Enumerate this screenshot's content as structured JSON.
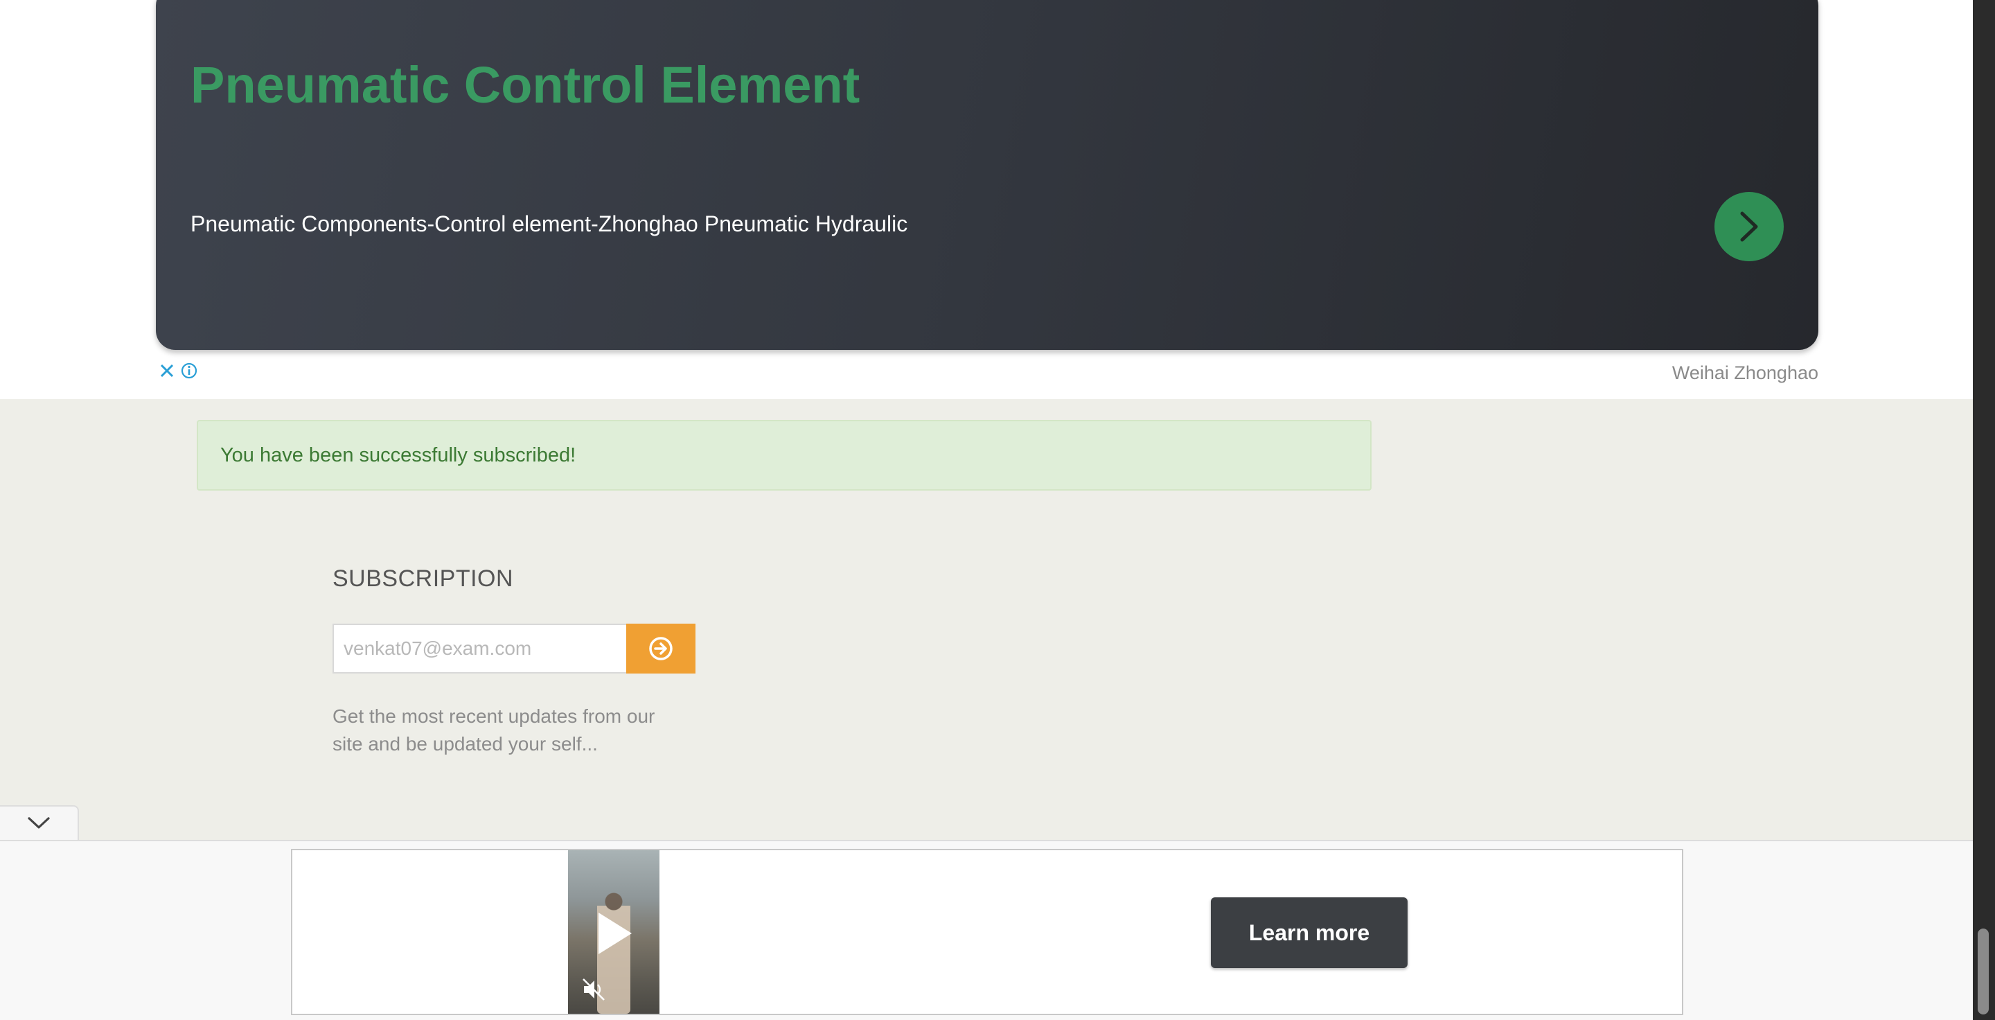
{
  "top_ad": {
    "title": "Pneumatic Control Element",
    "description": "Pneumatic Components-Control element-Zhonghao Pneumatic Hydraulic",
    "advertiser": "Weihai Zhonghao",
    "title_color": "#3a9a62",
    "arrow_color": "#2f8f55",
    "icons": [
      "close-icon",
      "info-icon",
      "chevron-right-icon"
    ]
  },
  "alert": {
    "message": "You have been successfully subscribed!"
  },
  "subscription": {
    "heading": "SUBSCRIPTION",
    "email_placeholder": "venkat07@exam.com",
    "submit_icon": "arrow-circle-right-icon",
    "button_color": "#f0a033",
    "description": "Get the most recent updates from our site and be updated your self..."
  },
  "collapse_tab": {
    "icon": "chevron-down-icon"
  },
  "bottom_ad": {
    "cta_label": "Learn more",
    "icons": [
      "play-icon",
      "muted-speaker-icon"
    ]
  }
}
